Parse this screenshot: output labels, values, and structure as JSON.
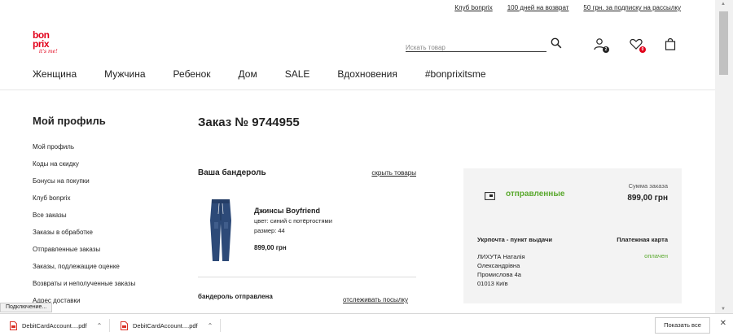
{
  "top_links": [
    "Клуб bonprix",
    "100 дней на возврат",
    "50 грн. за подписку на рассылку"
  ],
  "logo": {
    "line1": "bon",
    "line2": "prix",
    "line3": "it's me!"
  },
  "search": {
    "placeholder": "Искать товар"
  },
  "header_icons": {
    "account_badge": "2",
    "wishlist_badge": "0"
  },
  "nav": [
    "Женщина",
    "Мужчина",
    "Ребенок",
    "Дом",
    "SALE",
    "Вдохновения",
    "#bonprixitsme"
  ],
  "sidebar": {
    "title": "Мой профиль",
    "items": [
      "Мой профиль",
      "Коды на скидку",
      "Бонусы на покупки",
      "Клуб bonprix",
      "Все заказы",
      "Заказы в обработке",
      "Отправленные заказы",
      "Заказы, подлежащие оценке",
      "Возвраты и неполученные заказы",
      "Адрес доставки"
    ]
  },
  "order": {
    "title": "Заказ № 9744955",
    "parcel_title": "Ваша бандероль",
    "hide_items": "скрыть товары",
    "product": {
      "name": "Джинсы Boyfriend",
      "color": "цвет: синий с потёртостями",
      "size": "размер: 44",
      "price": "899,00 грн"
    },
    "parcel_sent": "бандероль отправлена",
    "track_link": "отслеживать посылку"
  },
  "panel": {
    "status": "отправленные",
    "sum_label": "Сумма заказа",
    "sum": "899,00 грн",
    "ship_title": "Укрпочта - пункт выдачи",
    "pay_title": "Платежная карта",
    "address_lines": [
      "ЛИХУТА Наталія",
      "Олександрівна",
      "Промислова 4а",
      "01013 Київ"
    ],
    "payment_status": "оплачен"
  },
  "status_popup": "Подключение...",
  "downloads": {
    "items": [
      "DebitCardAccount....pdf",
      "DebitCardAccount....pdf"
    ],
    "show_all": "Показать все"
  },
  "colors": {
    "brand": "#e2001a",
    "status_green": "#5aa92e",
    "panel_bg": "#f3f3f3"
  }
}
